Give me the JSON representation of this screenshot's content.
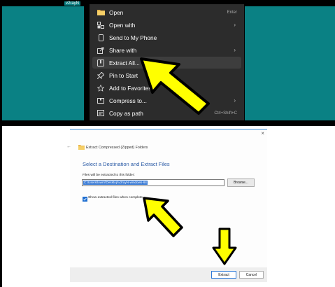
{
  "top_panel": {
    "file_label": "v2rayN",
    "menu_items": [
      {
        "label": "Open",
        "shortcut": "Enter",
        "icon": "open-folder-icon",
        "submenu": false
      },
      {
        "label": "Open with",
        "shortcut": "",
        "icon": "open-with-icon",
        "submenu": true
      },
      {
        "label": "Send to My Phone",
        "shortcut": "",
        "icon": "phone-icon",
        "submenu": false
      },
      {
        "label": "Share with",
        "shortcut": "",
        "icon": "share-icon",
        "submenu": true
      },
      {
        "label": "Extract All...",
        "shortcut": "",
        "icon": "extract-icon",
        "submenu": false,
        "highlighted": true
      },
      {
        "label": "Pin to Start",
        "shortcut": "",
        "icon": "pin-icon",
        "submenu": false
      },
      {
        "label": "Add to Favorites",
        "shortcut": "",
        "icon": "star-icon",
        "submenu": false
      },
      {
        "label": "Compress to...",
        "shortcut": "",
        "icon": "compress-icon",
        "submenu": true
      },
      {
        "label": "Copy as path",
        "shortcut": "Ctrl+Shift+C",
        "icon": "copy-path-icon",
        "submenu": false
      }
    ],
    "chevron": "›"
  },
  "dialog": {
    "close_glyph": "×",
    "back_glyph": "←",
    "window_title": "Extract Compressed (Zipped) Folders",
    "heading": "Select a Destination and Extract Files",
    "destination_label": "Files will be extracted to this folder:",
    "destination_path": "C:\\Users\\lowrn\\Desktop\\v2rayN-windows-64",
    "browse_label": "Browse...",
    "show_files_label": "Show extracted files when complete",
    "show_files_checked": true,
    "extract_label": "Extract",
    "cancel_label": "Cancel"
  },
  "colors": {
    "desktop_teal": "#0a8184",
    "menu_bg": "#2c2c2c",
    "arrow_yellow": "#ffff00",
    "accent_blue": "#2a5aa5",
    "selection_blue": "#3a7bd5"
  }
}
